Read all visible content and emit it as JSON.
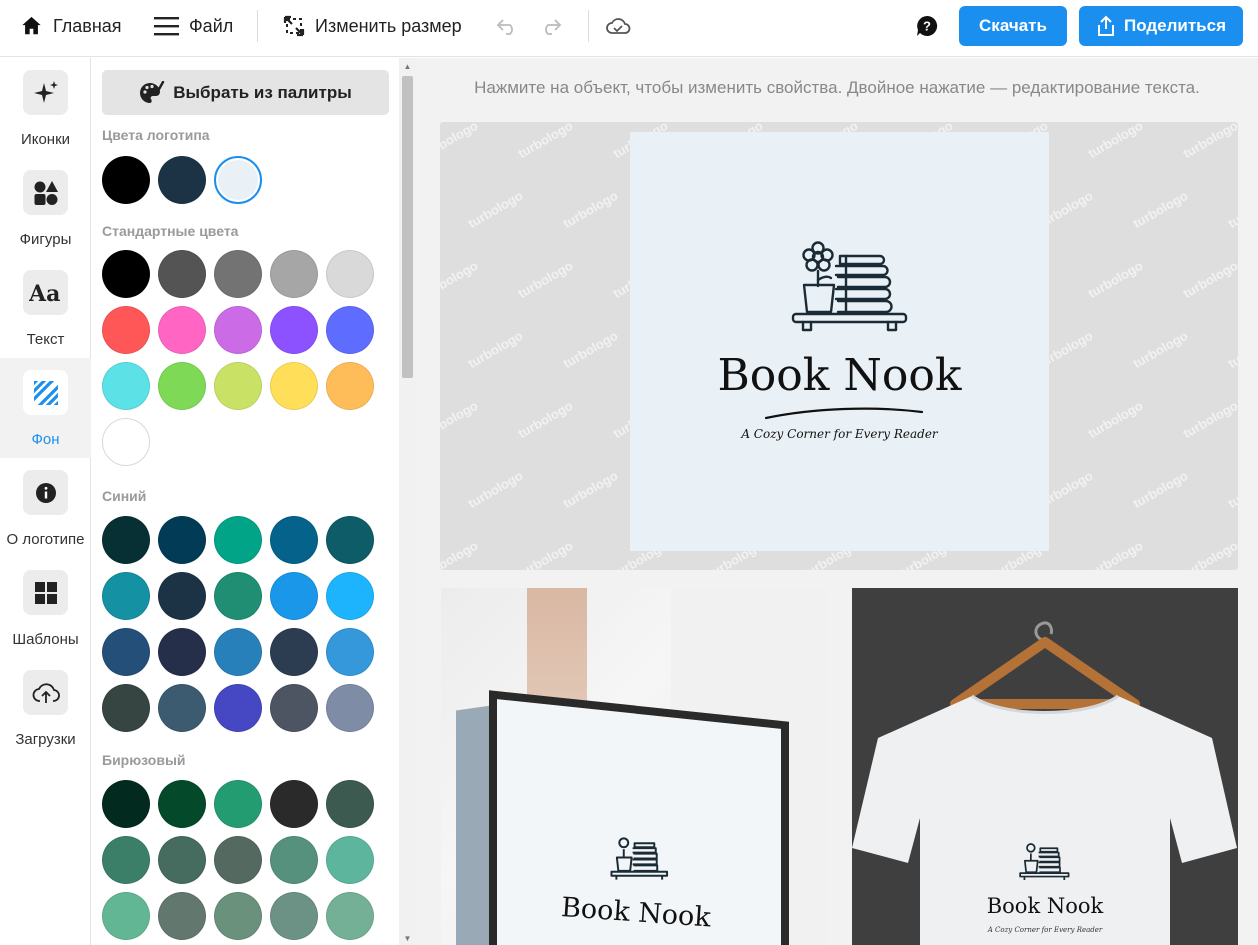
{
  "topbar": {
    "home_label": "Главная",
    "file_label": "Файл",
    "resize_label": "Изменить размер",
    "download_label": "Скачать",
    "share_label": "Поделиться"
  },
  "rail": {
    "items": [
      {
        "label": "Иконки",
        "icon": "sparkle-icon"
      },
      {
        "label": "Фигуры",
        "icon": "shapes-icon"
      },
      {
        "label": "Текст",
        "icon": "text-icon"
      },
      {
        "label": "Фон",
        "icon": "background-icon"
      },
      {
        "label": "О логотипе",
        "icon": "info-icon"
      },
      {
        "label": "Шаблоны",
        "icon": "templates-icon"
      },
      {
        "label": "Загрузки",
        "icon": "upload-icon"
      }
    ],
    "active": "Фон"
  },
  "panel": {
    "palette_button": "Выбрать из палитры",
    "sections": {
      "logo": {
        "title": "Цвета логотипа",
        "colors": [
          "#000000",
          "#1b3344",
          "#eaf1f6"
        ],
        "selected": "#eaf1f6"
      },
      "standard": {
        "title": "Стандартные цвета",
        "colors": [
          "#000000",
          "#545454",
          "#737373",
          "#a6a6a6",
          "#d9d9d9",
          "#ff5757",
          "#ff66c4",
          "#cb6ce6",
          "#8c52ff",
          "#5e6cff",
          "#5ce1e6",
          "#7ed957",
          "#c9e265",
          "#ffde59",
          "#ffbd59",
          "#ffffff"
        ]
      },
      "blue": {
        "title": "Синий",
        "colors": [
          "#073034",
          "#023b56",
          "#02a487",
          "#05628a",
          "#0e5c68",
          "#1491a3",
          "#1b3344",
          "#1f8e72",
          "#1a97e8",
          "#1eb3fd",
          "#244f78",
          "#252f4a",
          "#2880ba",
          "#2c3d52",
          "#3498db",
          "#364442",
          "#3c5b70",
          "#4548c2",
          "#4e5562",
          "#7f8ca5"
        ]
      },
      "turquoise": {
        "title": "Бирюзовый",
        "colors": [
          "#022a1e",
          "#04492a",
          "#249c72",
          "#2a2a2a",
          "#3d5a50",
          "#3c7f68",
          "#456c5e",
          "#546a60",
          "#56917e",
          "#5db59d",
          "#63b694",
          "#62776e",
          "#6a917c",
          "#6c9286",
          "#74b095"
        ]
      }
    }
  },
  "canvas": {
    "hint": "Нажмите на объект, чтобы изменить свойства. Двойное нажатие — редактирование текста.",
    "brand_name": "Book Nook",
    "tagline": "A Cozy Corner for Every Reader",
    "logo_bg": "#eaf1f6",
    "watermark": "turbologo"
  }
}
